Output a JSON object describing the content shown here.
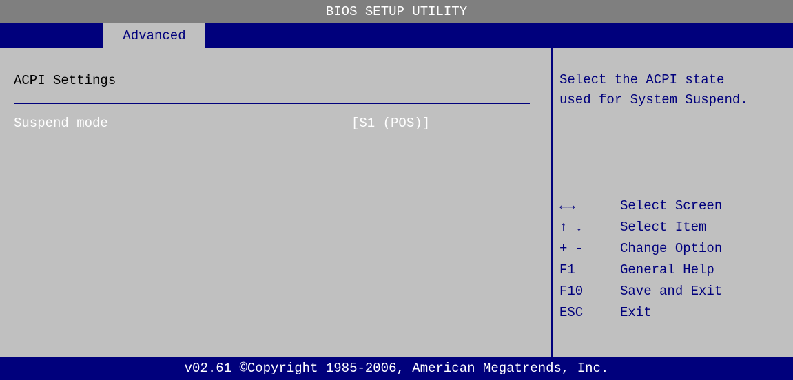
{
  "header": {
    "title": "BIOS SETUP UTILITY"
  },
  "tabs": [
    {
      "label": "Advanced"
    }
  ],
  "main": {
    "section_title": "ACPI Settings",
    "settings": [
      {
        "label": "Suspend mode",
        "value": "[S1 (POS)]"
      }
    ]
  },
  "help": {
    "lines": [
      "Select the ACPI state",
      "used for System Suspend."
    ],
    "keys": [
      {
        "key": "←→",
        "action": "Select Screen"
      },
      {
        "key": "↑ ↓",
        "action": "Select Item"
      },
      {
        "key": "+ -",
        "action": "Change Option"
      },
      {
        "key": "F1",
        "action": "General Help"
      },
      {
        "key": "F10",
        "action": "Save and Exit"
      },
      {
        "key": "ESC",
        "action": "Exit"
      }
    ]
  },
  "footer": {
    "copyright": "v02.61 ©Copyright 1985-2006, American Megatrends, Inc."
  },
  "colors": {
    "background": "#c0c0c0",
    "title_bar": "#7f7f7f",
    "accent_blue": "#00007c",
    "highlight_text": "#ffffff"
  }
}
